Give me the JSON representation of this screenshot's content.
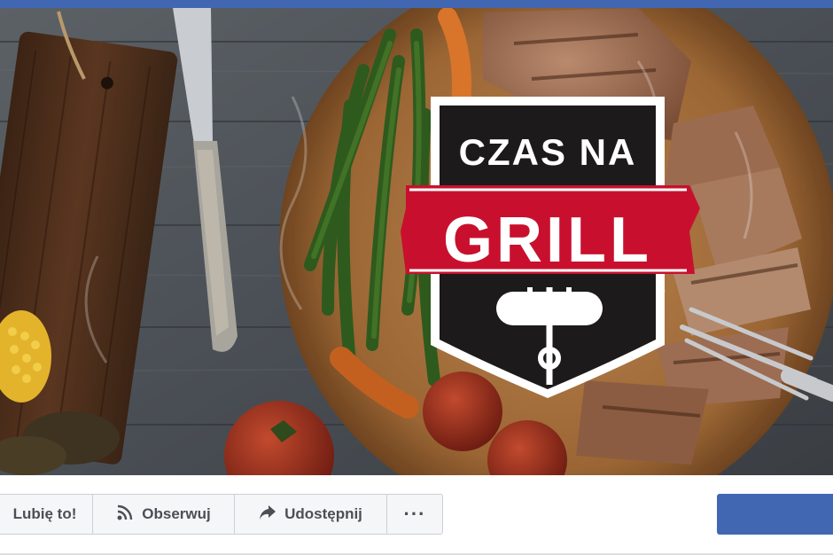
{
  "cover": {
    "logo_line1": "CZAS NA",
    "logo_line2": "GRILL"
  },
  "actions": {
    "like_label": "Lubię to!",
    "follow_label": "Obserwuj",
    "share_label": "Udostępnij",
    "more_label": "···"
  },
  "icons": {
    "follow": "rss-icon",
    "share": "share-arrow-icon",
    "more": "more-dots-icon"
  },
  "colors": {
    "nav": "#4267b2",
    "cta": "#4267b2",
    "logo_red": "#c8102e",
    "logo_black": "#1c1a1b"
  }
}
